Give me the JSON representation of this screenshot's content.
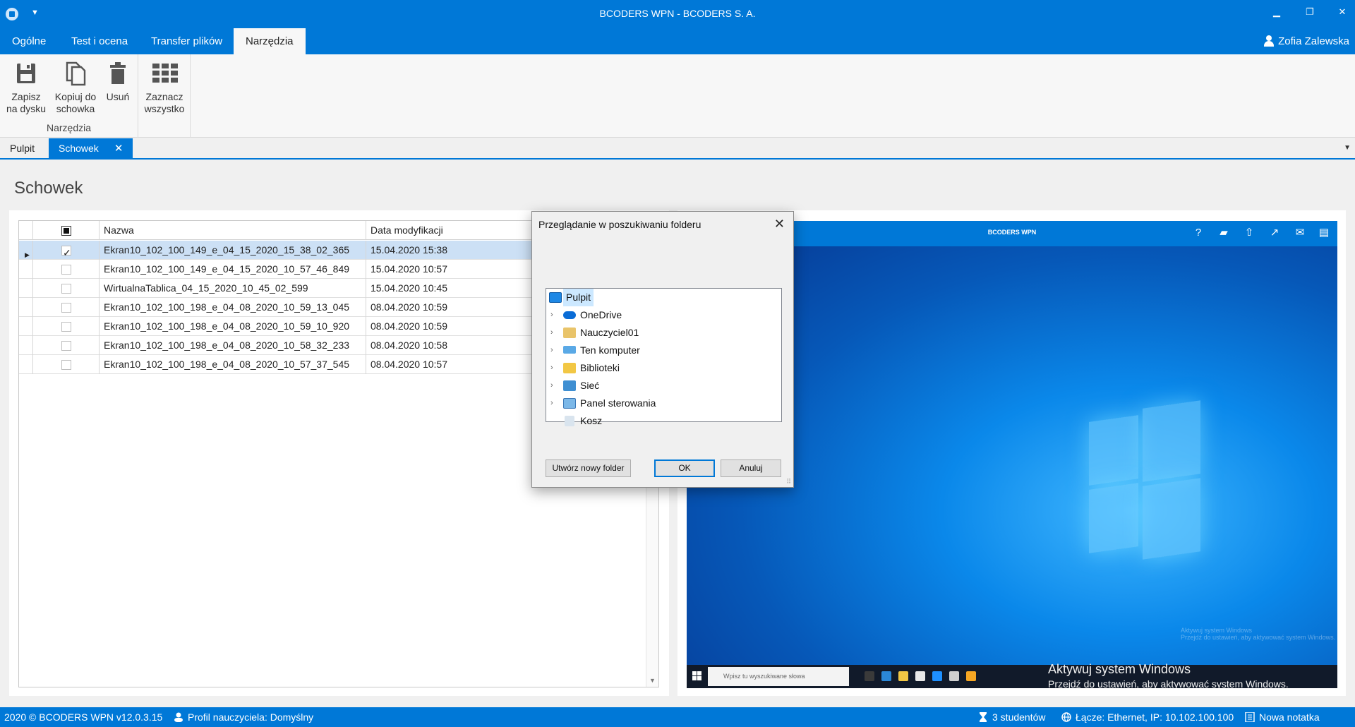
{
  "window": {
    "title": "BCODERS WPN - BCODERS S. A.",
    "minimize": "▁",
    "restore": "❐",
    "close": "✕"
  },
  "menu": {
    "tabs": [
      "Ogólne",
      "Test i ocena",
      "Transfer plików",
      "Narzędzia"
    ],
    "active": "Narzędzia",
    "user": "Zofia Zalewska"
  },
  "ribbon": {
    "buttons": [
      {
        "label_line1": "Zapisz",
        "label_line2": "na dysku",
        "icon": "save-icon"
      },
      {
        "label_line1": "Kopiuj do",
        "label_line2": "schowka",
        "icon": "copy-icon"
      },
      {
        "label_line1": "Usuń",
        "label_line2": "",
        "icon": "trash-icon"
      },
      {
        "label_line1": "Zaznacz",
        "label_line2": "wszystko",
        "icon": "grid-icon"
      }
    ],
    "group_label": "Narzędzia"
  },
  "doc_tabs": [
    "Pulpit",
    "Schowek"
  ],
  "doc_tab_close": "✕",
  "page": {
    "title": "Schowek"
  },
  "grid": {
    "columns": [
      "Nazwa",
      "Data modyfikacji"
    ],
    "rows": [
      {
        "name": "Ekran10_102_100_149_e_04_15_2020_15_38_02_365",
        "date": "15.04.2020 15:38",
        "checked": true
      },
      {
        "name": "Ekran10_102_100_149_e_04_15_2020_10_57_46_849",
        "date": "15.04.2020 10:57",
        "checked": false
      },
      {
        "name": "WirtualnaTablica_04_15_2020_10_45_02_599",
        "date": "15.04.2020 10:45",
        "checked": false
      },
      {
        "name": "Ekran10_102_100_198_e_04_08_2020_10_59_13_045",
        "date": "08.04.2020 10:59",
        "checked": false
      },
      {
        "name": "Ekran10_102_100_198_e_04_08_2020_10_59_10_920",
        "date": "08.04.2020 10:59",
        "checked": false
      },
      {
        "name": "Ekran10_102_100_198_e_04_08_2020_10_58_32_233",
        "date": "08.04.2020 10:58",
        "checked": false
      },
      {
        "name": "Ekran10_102_100_198_e_04_08_2020_10_57_37_545",
        "date": "08.04.2020 10:57",
        "checked": false
      }
    ]
  },
  "preview": {
    "app_title": "BCODERS WPN",
    "search_placeholder": "Wpisz tu wyszukiwane słowa",
    "activate_title": "Aktywuj system Windows",
    "activate_sub": "Przejdź do ustawień, aby aktywować system Windows.",
    "ghost_title": "Aktywuj system Windows",
    "ghost_sub": "Przejdź do ustawień, aby aktywować system Windows."
  },
  "dialog": {
    "title": "Przeglądanie w poszukiwaniu folderu",
    "close": "✕",
    "tree": [
      {
        "label": "Pulpit",
        "icon": "desktop-icon",
        "root": true
      },
      {
        "label": "OneDrive",
        "icon": "onedrive-icon"
      },
      {
        "label": "Nauczyciel01",
        "icon": "user-folder-icon"
      },
      {
        "label": "Ten komputer",
        "icon": "computer-icon"
      },
      {
        "label": "Biblioteki",
        "icon": "libraries-icon"
      },
      {
        "label": "Sieć",
        "icon": "network-icon"
      },
      {
        "label": "Panel sterowania",
        "icon": "control-panel-icon"
      },
      {
        "label": "Kosz",
        "icon": "recycle-bin-icon"
      }
    ],
    "new_folder": "Utwórz nowy folder",
    "ok": "OK",
    "cancel": "Anuluj"
  },
  "status": {
    "left": "2020 ©  BCODERS WPN v12.0.3.15",
    "profile": "Profil nauczyciela: Domyślny",
    "students": "3 studentów",
    "connection": "Łącze: Ethernet, IP: 10.102.100.100",
    "note": "Nowa notatka"
  },
  "colors": {
    "accent": "#0078d7",
    "selection": "#cce0f5"
  }
}
